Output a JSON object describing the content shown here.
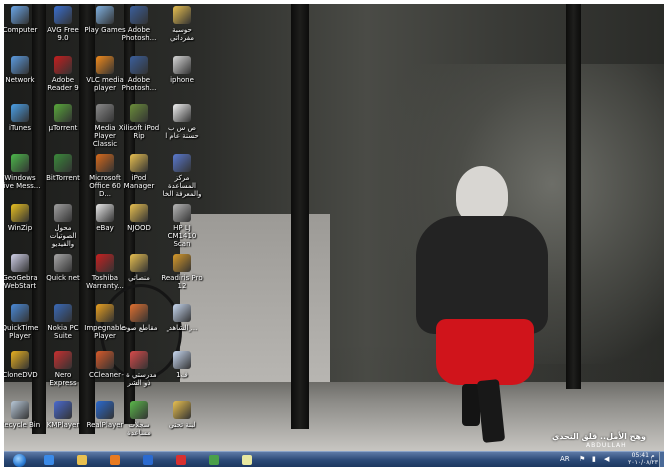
{
  "desktop": {
    "icons": [
      {
        "label": "Computer",
        "icon": "computer-icon",
        "color": "#6aa6e8"
      },
      {
        "label": "AVG Free 9.0",
        "icon": "avg-icon",
        "color": "#3a6fd0"
      },
      {
        "label": "Play Games",
        "icon": "games-icon",
        "color": "#7fb0e0"
      },
      {
        "label": "Adobe\nPhotosh...",
        "icon": "photoshop-icon",
        "color": "#3b5f9c"
      },
      {
        "label": "حوسبة مفرداتي",
        "icon": "folder-icon",
        "color": "#e8c050"
      },
      {
        "label": "Network",
        "icon": "network-icon",
        "color": "#5b9be0"
      },
      {
        "label": "Adobe\nReader 9",
        "icon": "pdf-icon",
        "color": "#c41e1e"
      },
      {
        "label": "VLC media\nplayer",
        "icon": "vlc-icon",
        "color": "#f08a1c"
      },
      {
        "label": "Adobe\nPhotosh...",
        "icon": "photoshop-icon",
        "color": "#3b5f9c"
      },
      {
        "label": "iphone",
        "icon": "phone-icon",
        "color": "#d8d8d8"
      },
      {
        "label": "iTunes",
        "icon": "itunes-icon",
        "color": "#4aa0e8"
      },
      {
        "label": "µTorrent",
        "icon": "utorrent-icon",
        "color": "#58a83a"
      },
      {
        "label": "Media Player\nClassic",
        "icon": "mediaplayer-icon",
        "color": "#8a8a8a"
      },
      {
        "label": "Xilisoft iPod\nRip",
        "icon": "ipod-icon",
        "color": "#6b8e3a"
      },
      {
        "label": "ص س ب\nحسنة عام ا",
        "icon": "document-icon",
        "color": "#f2f2f2"
      },
      {
        "label": "Windows\nLive Mess...",
        "icon": "messenger-icon",
        "color": "#4cb84a"
      },
      {
        "label": "BitTorrent",
        "icon": "bittorrent-icon",
        "color": "#3a8a3a"
      },
      {
        "label": "Microsoft\nOffice 60 D...",
        "icon": "office-icon",
        "color": "#d86a1c"
      },
      {
        "label": "iPod\nManager",
        "icon": "folder-icon",
        "color": "#e8c050"
      },
      {
        "label": "مركز المساعدة\nوالمعرفة الخا",
        "icon": "help-icon",
        "color": "#5a7ad0"
      },
      {
        "label": "WinZip",
        "icon": "winzip-icon",
        "color": "#e8c020"
      },
      {
        "label": "محول الصوتيات\nوالفيديو",
        "icon": "converter-icon",
        "color": "#a0a0a0"
      },
      {
        "label": "eBay",
        "icon": "ebay-icon",
        "color": "#e8e8e8"
      },
      {
        "label": "NJOOD",
        "icon": "folder-icon",
        "color": "#e8c050"
      },
      {
        "label": "HP LJ\nCM1410 Scan",
        "icon": "scanner-icon",
        "color": "#b8b8b8"
      },
      {
        "label": "GeoGebra\nWebStart",
        "icon": "geogebra-icon",
        "color": "#d0d0e8"
      },
      {
        "label": "Quick net",
        "icon": "network-icon",
        "color": "#a8a8a8"
      },
      {
        "label": "Toshiba\nWarranty...",
        "icon": "toshiba-icon",
        "color": "#c82020"
      },
      {
        "label": "منصاتي",
        "icon": "folder-icon",
        "color": "#e8c050"
      },
      {
        "label": "Readiris Pro\n12",
        "icon": "readiris-icon",
        "color": "#d89a2a"
      },
      {
        "label": "QuickTime\nPlayer",
        "icon": "quicktime-icon",
        "color": "#4a8ad8"
      },
      {
        "label": "Nokia PC\nSuite",
        "icon": "nokia-icon",
        "color": "#3a6ab8"
      },
      {
        "label": "Impegnable\nPlayer",
        "icon": "player-icon",
        "color": "#e8a020"
      },
      {
        "label": "مقاطع صوت",
        "icon": "audio-icon",
        "color": "#e07030"
      },
      {
        "label": "ٍ الشاهد ٍ...",
        "icon": "document-icon",
        "color": "#c8d8f0"
      },
      {
        "label": "CloneDVD",
        "icon": "clonedvd-icon",
        "color": "#e8b020"
      },
      {
        "label": "Nero Express",
        "icon": "nero-icon",
        "color": "#c83030"
      },
      {
        "label": "CCleaner",
        "icon": "ccleaner-icon",
        "color": "#d85a2a"
      },
      {
        "label": "- مدرستي ة\nذو الشر",
        "icon": "heart-icon",
        "color": "#d84a4a"
      },
      {
        "label": "ف1",
        "icon": "document-icon",
        "color": "#c8d8f0"
      },
      {
        "label": "Recycle Bin",
        "icon": "recycle-bin-icon",
        "color": "#b8c8d8"
      },
      {
        "label": "KMPlayer",
        "icon": "kmplayer-icon",
        "color": "#4a6ad0"
      },
      {
        "label": "RealPlayer",
        "icon": "realplayer-icon",
        "color": "#2a6ad0"
      },
      {
        "label": "سجلات مساعدة",
        "icon": "checkmark-icon",
        "color": "#5ab84a"
      },
      {
        "label": "لبنة تحتي",
        "icon": "folder-icon",
        "color": "#e8c050"
      }
    ]
  },
  "wallpaper": {
    "caption": "وهج الأمل.. قلق التحدي",
    "signature": "ABDULLAH"
  },
  "taskbar": {
    "start_icon": "windows-start-icon",
    "pinned": [
      {
        "name": "ie",
        "icon": "internet-explorer-icon",
        "color": "#3a8ae8"
      },
      {
        "name": "explorer",
        "icon": "folder-icon",
        "color": "#e8c050"
      },
      {
        "name": "media",
        "icon": "media-player-icon",
        "color": "#e87a20"
      },
      {
        "name": "messenger",
        "icon": "messenger-icon",
        "color": "#2a6ad0"
      },
      {
        "name": "pin",
        "icon": "pin-icon",
        "color": "#d83030"
      },
      {
        "name": "network",
        "icon": "network-icon",
        "color": "#4aa04a"
      },
      {
        "name": "paint",
        "icon": "paint-icon",
        "color": "#e8e8a0"
      }
    ],
    "language": "AR",
    "time": "05:41 م",
    "date": "٢٠١٠/٠٨/٢٣"
  }
}
